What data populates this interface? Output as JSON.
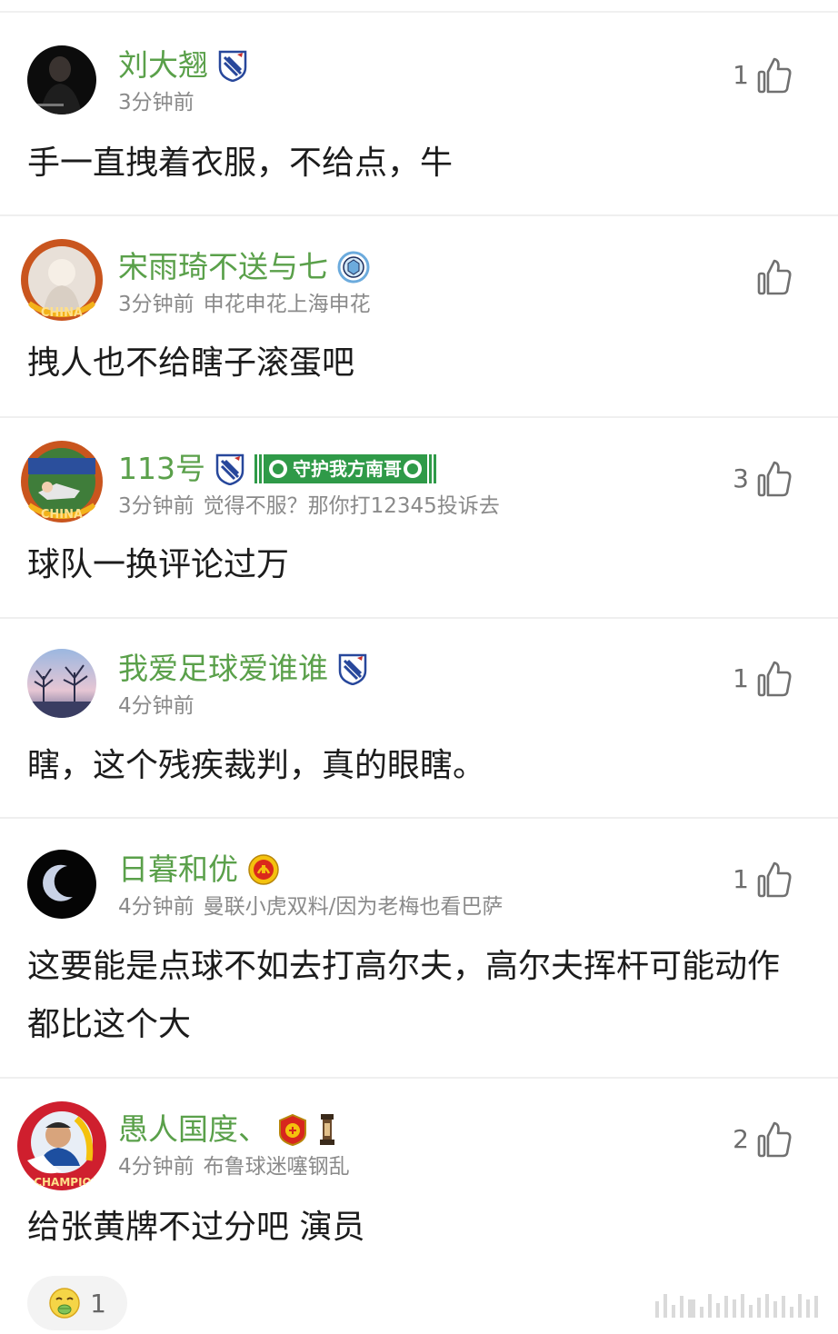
{
  "comments": [
    {
      "name": "刘大翘",
      "time": "3分钟前",
      "signature": "",
      "text": "手一直拽着衣服，不给点，牛",
      "likes": "1",
      "badges": [
        "shenhua-badge"
      ]
    },
    {
      "name": "宋雨琦不送与七",
      "time": "3分钟前",
      "signature": "申花申花上海申花",
      "text": "拽人也不给瞎子滚蛋吧",
      "likes": "",
      "badges": [
        "mancity-badge"
      ]
    },
    {
      "name": "113号",
      "time": "3分钟前",
      "signature": "觉得不服？那你打12345投诉去",
      "text": "球队一换评论过万",
      "likes": "3",
      "badges": [
        "shenhua-badge",
        "fan-scarf-badge"
      ],
      "scarf_text": "守护我方南哥"
    },
    {
      "name": "我爱足球爱谁谁",
      "time": "4分钟前",
      "signature": "",
      "text": "瞎，这个残疾裁判，真的眼瞎。",
      "likes": "1",
      "badges": [
        "shenhua-badge"
      ]
    },
    {
      "name": "日暮和优",
      "time": "4分钟前",
      "signature": "曼联小虎双料/因为老梅也看巴萨",
      "text": "这要能是点球不如去打高尔夫，高尔夫挥杆可能动作都比这个大",
      "likes": "1",
      "badges": [
        "manutd-badge"
      ]
    },
    {
      "name": "愚人国度、",
      "time": "4分钟前",
      "signature": "布鲁球迷噻钢乱",
      "text": "给张黄牌不过分吧 演员",
      "likes": "2",
      "badges": [
        "port-badge",
        "trophy-badge"
      ]
    }
  ],
  "reaction": {
    "icon": "sick-face-icon",
    "count": "1"
  },
  "colors": {
    "name_green": "#5aa04a",
    "meta_gray": "#8a8a8a",
    "divider": "#efefef"
  }
}
